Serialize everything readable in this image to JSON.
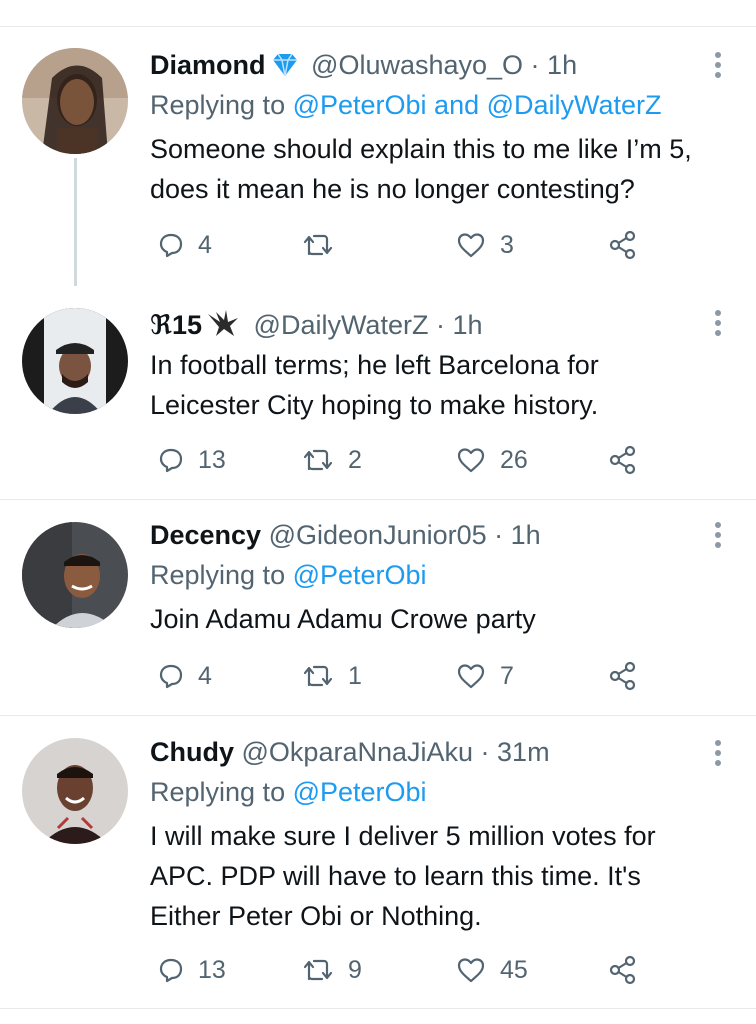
{
  "tweets": [
    {
      "name": "Diamond",
      "handle": "@Oluwashayo_O",
      "time": "1h",
      "replying_prefix": "Replying to ",
      "replying_to": "@PeterObi and @DailyWaterZ",
      "text_lines": [
        "Someone should explain this to me like I’m 5,",
        "does it mean he is no longer contesting?"
      ],
      "replies": "4",
      "retweets": "",
      "likes": "3"
    },
    {
      "name": "ℜ15",
      "handle": "@DailyWaterZ",
      "time": "1h",
      "text_lines": [
        "In football terms; he left Barcelona for",
        "Leicester City hoping to make history."
      ],
      "replies": "13",
      "retweets": "2",
      "likes": "26"
    },
    {
      "name": "Decency",
      "handle": "@GideonJunior05",
      "time": "1h",
      "replying_prefix": "Replying to ",
      "replying_to": "@PeterObi",
      "text_lines": [
        "Join Adamu Adamu Crowe party"
      ],
      "replies": "4",
      "retweets": "1",
      "likes": "7"
    },
    {
      "name": "Chudy",
      "handle": "@OkparaNnaJiAku",
      "time": "31m",
      "replying_prefix": "Replying to ",
      "replying_to": "@PeterObi",
      "text_lines": [
        "I will make sure I deliver 5 million votes for",
        "APC. PDP will have to learn this time. It's",
        "Either Peter Obi or Nothing."
      ],
      "replies": "13",
      "retweets": "9",
      "likes": "45"
    }
  ],
  "separator": " · ",
  "colors": {
    "link": "#1d9bf0",
    "muted": "#536471",
    "text": "#0f1419",
    "verified": "#1d9bf0"
  }
}
